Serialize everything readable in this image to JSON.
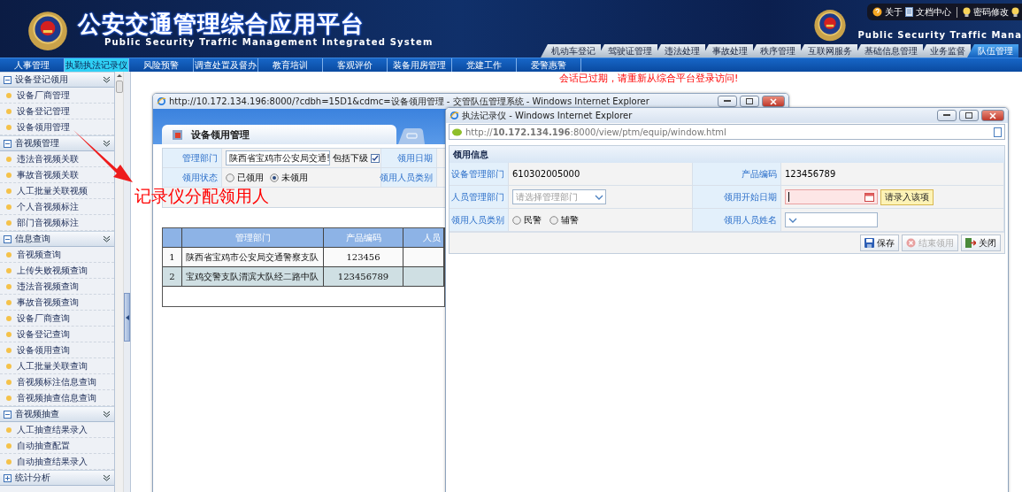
{
  "header": {
    "title": "公安交通管理综合应用平台",
    "subtitle": "Public Security Traffic Management Integrated System",
    "right_subtitle": "Public Security Traffic Mana",
    "toolbar": [
      {
        "label": "关于",
        "kind": "help"
      },
      {
        "label": "文档中心",
        "kind": "doc"
      },
      {
        "label": "密码修改",
        "kind": "bulb"
      }
    ]
  },
  "module_tabs": [
    {
      "label": "机动车登记",
      "selected": false
    },
    {
      "label": "驾驶证管理",
      "selected": false
    },
    {
      "label": "违法处理",
      "selected": false
    },
    {
      "label": "事故处理",
      "selected": false
    },
    {
      "label": "秩序管理",
      "selected": false
    },
    {
      "label": "互联网服务",
      "selected": false
    },
    {
      "label": "基础信息管理",
      "selected": false
    },
    {
      "label": "业务监督",
      "selected": false
    },
    {
      "label": "队伍管理",
      "selected": true
    }
  ],
  "nav": [
    {
      "label": "人事管理",
      "selected": false
    },
    {
      "label": "执勤执法记录仪",
      "selected": true
    },
    {
      "label": "风险预警",
      "selected": false
    },
    {
      "label": "调查处置及督办",
      "selected": false
    },
    {
      "label": "教育培训",
      "selected": false
    },
    {
      "label": "客观评价",
      "selected": false
    },
    {
      "label": "装备用房管理",
      "selected": false
    },
    {
      "label": "党建工作",
      "selected": false
    },
    {
      "label": "爱警惠警",
      "selected": false
    }
  ],
  "sidebar": {
    "sections": [
      {
        "title": "设备登记领用",
        "expanded": true,
        "items": [
          "设备厂商管理",
          "设备登记管理",
          "设备领用管理"
        ]
      },
      {
        "title": "音视频管理",
        "expanded": true,
        "items": [
          "违法音视频关联",
          "事故音视频关联",
          "人工批量关联视频",
          "个人音视频标注",
          "部门音视频标注"
        ]
      },
      {
        "title": "信息查询",
        "expanded": true,
        "items": [
          "音视频查询",
          "上传失败视频查询",
          "违法音视频查询",
          "事故音视频查询",
          "设备厂商查询",
          "设备登记查询",
          "设备领用查询",
          "人工批量关联查询",
          "音视频标注信息查询",
          "音视频抽查信息查询"
        ]
      },
      {
        "title": "音视频抽查",
        "expanded": true,
        "items": [
          "人工抽查结果录入",
          "自动抽查配置",
          "自动抽查结果录入"
        ]
      },
      {
        "title": "统计分析",
        "expanded": false
      }
    ]
  },
  "session_message": "会话已过期，请重新从综合平台登录访问!",
  "annotation": "记录仪分配领用人",
  "back_window": {
    "title": "http://10.172.134.196:8000/?cdbh=15D1&cdmc=设备领用管理 - 交管队伍管理系统 - Windows Internet Explorer",
    "tab": "设备领用管理",
    "filters": {
      "dept_label": "管理部门",
      "dept_value": "陕西省宝鸡市公安局交通!",
      "include_sub_label": "包括下级",
      "include_sub_checked": true,
      "date_label": "领用日期",
      "status_label": "领用状态",
      "status_options": [
        {
          "label": "已领用",
          "selected": false
        },
        {
          "label": "未领用",
          "selected": true
        }
      ],
      "person_type_label": "领用人员类别"
    },
    "table": {
      "columns": [
        "管理部门",
        "产品编码",
        "人员"
      ],
      "rows": [
        {
          "index": "1",
          "dept": "陕西省宝鸡市公安局交通警察支队",
          "code": "123456",
          "selected": false
        },
        {
          "index": "2",
          "dept": "宝鸡交警支队渭滨大队经二路中队",
          "code": "123456789",
          "selected": true
        }
      ]
    }
  },
  "front_window": {
    "title": "执法记录仪 - Windows Internet Explorer",
    "address": "http://**10.172.134.196**:8000/view/ptm/equip/window.html",
    "panel_title": "领用信息",
    "rows": [
      [
        {
          "label": "设备管理部门",
          "kind": "text",
          "value": "610302005000"
        },
        {
          "label": "产品编码",
          "kind": "text",
          "value": "123456789"
        }
      ],
      [
        {
          "label": "人员管理部门",
          "kind": "select",
          "placeholder": "请选择管理部门"
        },
        {
          "label": "领用开始日期",
          "kind": "date",
          "error": "请录入该项"
        }
      ],
      [
        {
          "label": "领用人员类别",
          "kind": "radio",
          "options": [
            {
              "label": "民警",
              "selected": false
            },
            {
              "label": "辅警",
              "selected": false
            }
          ]
        },
        {
          "label": "领用人员姓名",
          "kind": "select"
        }
      ]
    ],
    "buttons": [
      {
        "label": "保存",
        "kind": "save",
        "disabled": false
      },
      {
        "label": "结束领用",
        "kind": "end",
        "disabled": true
      },
      {
        "label": "关闭",
        "kind": "close",
        "disabled": false
      }
    ]
  }
}
